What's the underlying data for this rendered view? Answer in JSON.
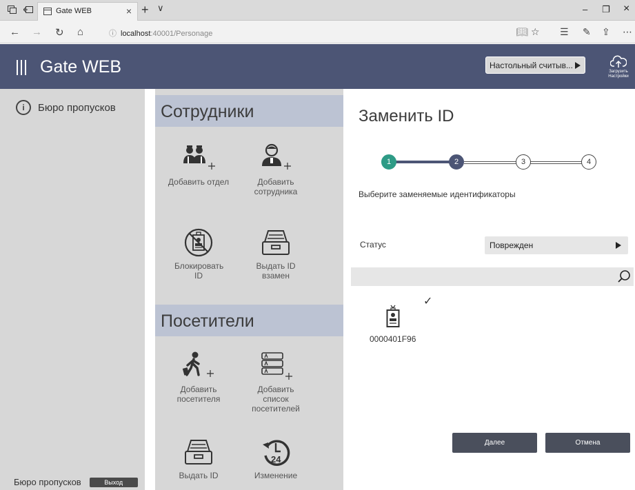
{
  "browser": {
    "tab_title": "Gate WEB",
    "tab_close": "×",
    "new_tab": "+",
    "tab_list": "∨",
    "url_host": "localhost",
    "url_path": ":40001/Personage",
    "url_info": "ⓘ",
    "win_min": "–",
    "win_max": "❐",
    "win_close": "×"
  },
  "header": {
    "title": "Gate WEB",
    "reader_label": "Настольный считыв...",
    "upload_label_1": "Загрузить",
    "upload_label_2": "Настройки"
  },
  "sidebar": {
    "item_label": "Бюро пропусков",
    "footer_user": "Бюро пропусков",
    "exit_label": "Выход"
  },
  "tiles": {
    "employees": {
      "title": "Сотрудники",
      "items": [
        {
          "label": "Добавить отдел",
          "icon": "add-department-icon"
        },
        {
          "label": "Добавить сотрудника",
          "icon": "add-employee-icon"
        },
        {
          "label": "Блокировать ID",
          "icon": "block-id-icon"
        },
        {
          "label": "Выдать ID взамен",
          "icon": "issue-replacement-id-icon"
        }
      ]
    },
    "visitors": {
      "title": "Посетители",
      "items": [
        {
          "label": "Добавить посетителя",
          "icon": "add-visitor-icon"
        },
        {
          "label": "Добавить список посетителей",
          "icon": "add-visitor-list-icon"
        },
        {
          "label": "Выдать ID",
          "icon": "issue-id-icon"
        },
        {
          "label": "Изменение",
          "icon": "change-history-icon"
        }
      ]
    }
  },
  "panel": {
    "title": "Заменить ID",
    "steps": [
      "1",
      "2",
      "3",
      "4"
    ],
    "current_step": 2,
    "instruction": "Выберите заменяемые идентификаторы",
    "status_label": "Статус",
    "status_value": "Поврежден",
    "search_placeholder": "",
    "card_number": "0000401F96",
    "card_checked": "✓",
    "next_label": "Далее",
    "cancel_label": "Отмена"
  },
  "colors": {
    "header": "#4c5575",
    "step_done": "#2e9b86",
    "step_current": "#4c5575",
    "group_header": "#bcc3d3",
    "sidebar": "#d7d7d7",
    "button": "#4a4f5c"
  }
}
